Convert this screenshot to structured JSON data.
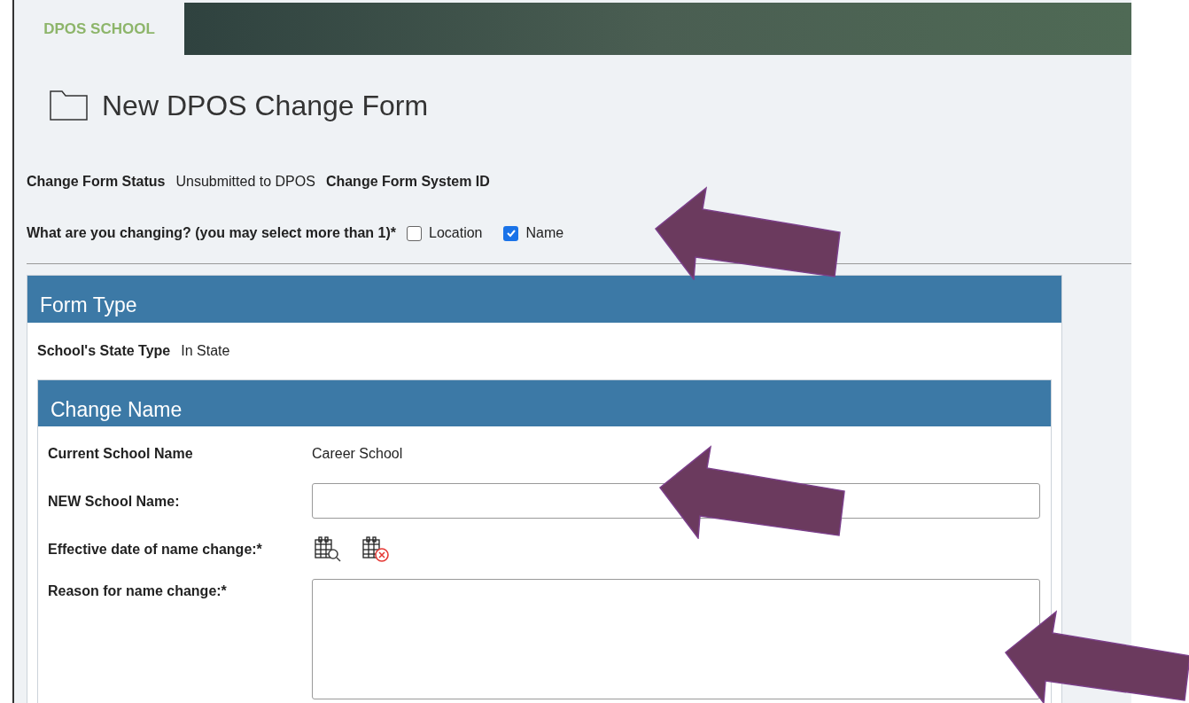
{
  "header": {
    "tab": "DPOS SCHOOL"
  },
  "title": "New DPOS Change Form",
  "status": {
    "label": "Change Form Status",
    "value": "Unsubmitted to DPOS",
    "id_label": "Change Form System ID"
  },
  "changing": {
    "label": "What are you changing? (you may select more than 1)*",
    "options": [
      {
        "label": "Location",
        "checked": false
      },
      {
        "label": "Name",
        "checked": true
      }
    ]
  },
  "form_type": {
    "title": "Form Type",
    "state_type_label": "School's State Type",
    "state_type_value": "In State",
    "change_name": {
      "title": "Change Name",
      "fields": [
        {
          "kind": "text",
          "label": "Current School Name",
          "value": "Career School"
        },
        {
          "kind": "input",
          "label": "NEW School Name:"
        },
        {
          "kind": "date",
          "label": "Effective date of name change:*"
        },
        {
          "kind": "textarea",
          "label": "Reason for name change:*"
        }
      ]
    }
  }
}
